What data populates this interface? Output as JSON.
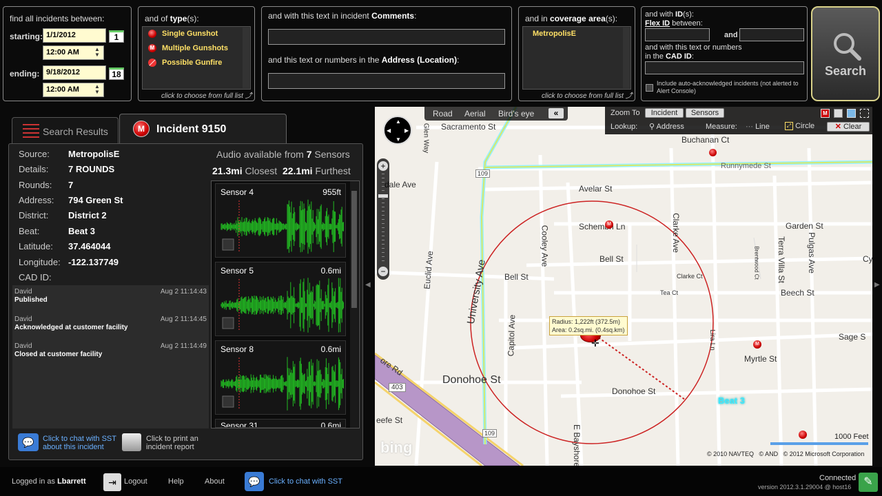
{
  "filters": {
    "date": {
      "title": "find all incidents between:",
      "starting_label": "starting:",
      "start_date": "1/1/2012",
      "start_day": "1",
      "start_time": "12:00 AM",
      "ending_label": "ending:",
      "end_date": "9/18/2012",
      "end_day": "18",
      "end_time": "12:00 AM"
    },
    "type": {
      "title_prefix": "and of ",
      "title_bold": "type",
      "title_suffix": "(s):",
      "items": [
        "Single Gunshot",
        "Multiple Gunshots",
        "Possible Gunfire"
      ],
      "hint": "click to choose from full list"
    },
    "comments": {
      "title_prefix": "and with this text in incident ",
      "title_bold": "Comments",
      "title_suffix": ":",
      "address_prefix": "and this text or numbers in the ",
      "address_bold": "Address (Location)",
      "address_suffix": ":"
    },
    "coverage": {
      "title_prefix": "and in ",
      "title_bold": "coverage area",
      "title_suffix": "(s):",
      "items": [
        "MetropolisE"
      ],
      "hint": "click to choose from full list"
    },
    "id": {
      "title_prefix": "and with ",
      "title_bold": "ID",
      "title_suffix": "(s):",
      "flex_bold": "Flex ID",
      "flex_suffix": " between:",
      "and_label": "and",
      "cad_line1": "and with this text or numbers",
      "cad_prefix": "in the ",
      "cad_bold": "CAD ID",
      "cad_suffix": ":",
      "auto_ack": "Include auto-acknowledged incidents (not alerted to Alert Console)"
    },
    "search_label": "Search"
  },
  "tabs": {
    "search_results": "Search Results",
    "incident": "Incident 9150"
  },
  "incident": {
    "fields": [
      {
        "label": "Source:",
        "value": "MetropolisE"
      },
      {
        "label": "Details:",
        "value": "7 ROUNDS"
      },
      {
        "label": "Rounds:",
        "value": "7"
      },
      {
        "label": "Address:",
        "value": "794 Green  St"
      },
      {
        "label": "District:",
        "value": "District 2"
      },
      {
        "label": "Beat:",
        "value": "Beat 3"
      },
      {
        "label": "Latitude:",
        "value": "37.464044"
      },
      {
        "label": "Longitude:",
        "value": "-122.137749"
      },
      {
        "label": "CAD ID:",
        "value": ""
      }
    ],
    "audio_prefix": "Audio available from ",
    "audio_count": "7",
    "audio_suffix": " Sensors",
    "closest_val": "21.3mi",
    "closest_label": " Closest",
    "furthest_val": "22.1mi",
    "furthest_label": " Furthest",
    "sensors": [
      {
        "name": "Sensor 4",
        "dist": "955ft"
      },
      {
        "name": "Sensor 5",
        "dist": "0.6mi"
      },
      {
        "name": "Sensor 8",
        "dist": "0.6mi"
      },
      {
        "name": "Sensor 31",
        "dist": "0.6mi"
      }
    ],
    "log": [
      {
        "who": "David",
        "when": "Aug 2 11:14:43",
        "what": "Published"
      },
      {
        "who": "David",
        "when": "Aug 2 11:14:45",
        "what": "Acknowledged at customer facility"
      },
      {
        "who": "David",
        "when": "Aug 2 11:14:49",
        "what": "Closed at customer facility"
      }
    ],
    "chat_label_1": "Click to chat with SST",
    "chat_label_2": "about this incident",
    "print_label_1": "Click to print an",
    "print_label_2": "incident report"
  },
  "map": {
    "views": [
      "Road",
      "Aerial",
      "Bird's eye"
    ],
    "collapse": "«",
    "zoom_to_label": "Zoom To",
    "zoom_incident": "Incident",
    "zoom_sensors": "Sensors",
    "lookup_label": "Lookup:",
    "address_label": "Address",
    "measure_label": "Measure:",
    "line_label": "Line",
    "circle_label": "Circle",
    "clear_label": "Clear",
    "radius_text": "Radius: 1,222ft (372.5m)",
    "area_text": "Area: 0.2sq.mi. (0.4sq.km)",
    "streets": [
      "Sacramento St",
      "Buchanan Ct",
      "Runnymede St",
      "Glen Way",
      "Avelar St",
      "Schembri Ln",
      "Garden St",
      "Bell St",
      "Bell St",
      "Cooley Ave",
      "University Ave",
      "Euclid Ave",
      "Clarke Ave",
      "Terra Villa St",
      "Pulgas Ave",
      "Cy",
      "Clarke Ct",
      "Beech St",
      "Tea Ct",
      "Capitol Ave",
      "Sage S",
      "Myrtle St",
      "Donohoe St",
      "Donohoe St",
      "E Bayshore",
      "ore Rd",
      "eefe St",
      "dale Ave",
      "Lira Ln",
      "Brentwood Ct"
    ],
    "route_labels": [
      "109",
      "403",
      "109"
    ],
    "beat_label": "Beat 3",
    "scale_label": "1000 Feet",
    "copyright": "© 2010 NAVTEQ   © AND   © 2012 Microsoft Corporation",
    "bing": "bing"
  },
  "footer": {
    "logged_prefix": "Logged in as ",
    "user": "Lbarrett",
    "logout": "Logout",
    "help": "Help",
    "about": "About",
    "chat": "Click to chat with SST",
    "connected": "Connected",
    "version": "version 2012.3.1.29004 @ host16"
  },
  "colors": {
    "accent_yellow": "#ffe066",
    "measure_circle": "#cc2222",
    "road_highlight": "#3de8ff"
  }
}
